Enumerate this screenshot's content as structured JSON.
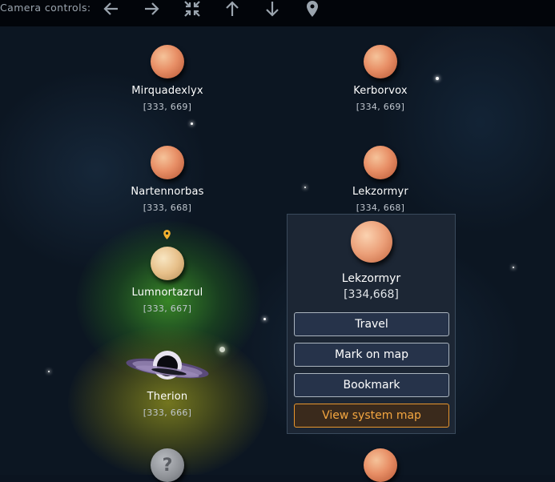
{
  "camera": {
    "label": "Camera controls:",
    "buttons": [
      {
        "name": "arrow-left-icon"
      },
      {
        "name": "arrow-right-icon"
      },
      {
        "name": "zoom-out-icon"
      },
      {
        "name": "arrow-up-icon"
      },
      {
        "name": "arrow-down-icon"
      },
      {
        "name": "map-pin-icon"
      }
    ]
  },
  "systems": [
    {
      "name": "Mirquadexlyx",
      "coords": "[333, 669]"
    },
    {
      "name": "Kerborvox",
      "coords": "[334, 669]"
    },
    {
      "name": "Nartennorbas",
      "coords": "[333, 668]"
    },
    {
      "name": "Lekzormyr",
      "coords": "[334, 668]"
    },
    {
      "name": "Lumnortazrul",
      "coords": "[333, 667]"
    },
    {
      "name": "Therion",
      "coords": "[333, 666]"
    },
    {
      "unknown_glyph": "?"
    }
  ],
  "popup": {
    "name": "Lekzormyr",
    "coords": "[334,668]",
    "buttons": {
      "travel": "Travel",
      "mark": "Mark on map",
      "bookmark": "Bookmark",
      "view_map": "View system map"
    }
  },
  "colors": {
    "accent_orange": "#f4a640",
    "panel_bg": "#1c2634",
    "background": "#0c1622"
  }
}
